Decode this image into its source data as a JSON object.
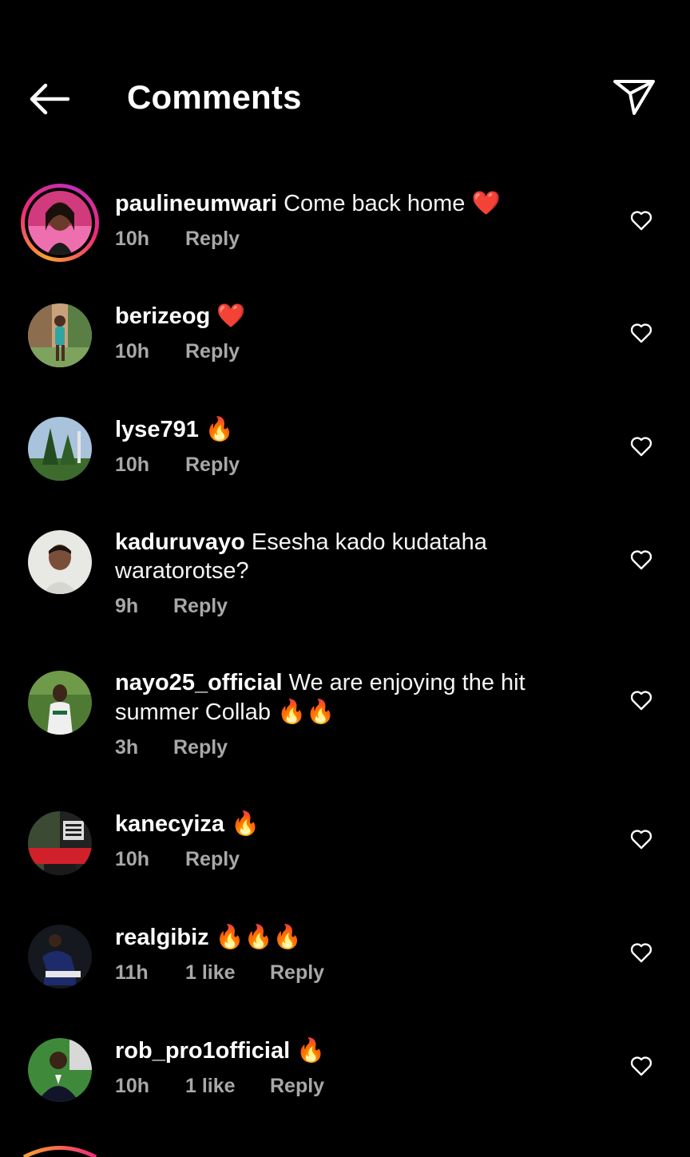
{
  "header": {
    "title": "Comments"
  },
  "comments": [
    {
      "username": "paulineumwari",
      "text": "Come back home",
      "emoji": "❤️",
      "time": "10h",
      "likes": "",
      "reply": "Reply",
      "story": true
    },
    {
      "username": "berizeog",
      "text": "",
      "emoji": "❤️",
      "time": "10h",
      "likes": "",
      "reply": "Reply",
      "story": false
    },
    {
      "username": "lyse791",
      "text": "",
      "emoji": "🔥",
      "time": "10h",
      "likes": "",
      "reply": "Reply",
      "story": false
    },
    {
      "username": "kaduruvayo",
      "text": "Esesha kado kudataha waratorotse?",
      "emoji": "",
      "time": "9h",
      "likes": "",
      "reply": "Reply",
      "story": false
    },
    {
      "username": "nayo25_official",
      "text": "We are enjoying the hit summer Collab",
      "emoji": "🔥🔥",
      "time": "3h",
      "likes": "",
      "reply": "Reply",
      "story": false
    },
    {
      "username": "kanecyiza",
      "text": "",
      "emoji": "🔥",
      "time": "10h",
      "likes": "",
      "reply": "Reply",
      "story": false
    },
    {
      "username": "realgibiz",
      "text": "",
      "emoji": "🔥🔥🔥",
      "time": "11h",
      "likes": "1 like",
      "reply": "Reply",
      "story": false
    },
    {
      "username": "rob_pro1official",
      "text": "",
      "emoji": "🔥",
      "time": "10h",
      "likes": "1 like",
      "reply": "Reply",
      "story": false
    }
  ],
  "icons": {
    "back": "arrow-left-icon",
    "share": "paper-plane-icon",
    "like": "heart-outline-icon"
  },
  "colors": {
    "background": "#000000",
    "text": "#ffffff",
    "meta": "#a8a8a8",
    "heart_emoji": "#e0245e",
    "fire_emoji": "#ff6a00"
  }
}
